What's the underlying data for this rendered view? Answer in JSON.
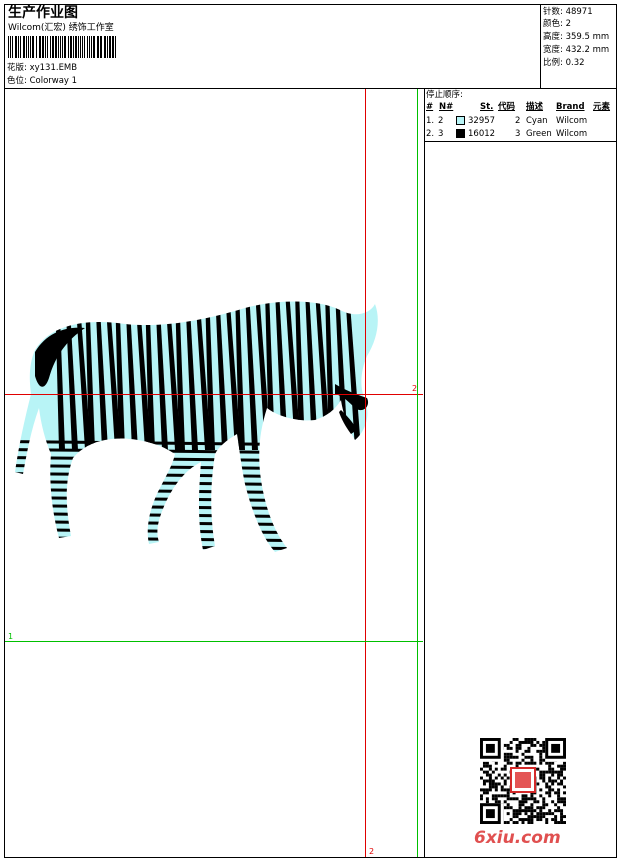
{
  "header": {
    "title": "生产作业图",
    "company": "Wilcom(汇宏) 绣饰工作室",
    "design_label": "花版:",
    "design_value": "xy131.EMB",
    "colorway_label": "色位:",
    "colorway_value": "Colorway 1"
  },
  "info": [
    {
      "label": "针数:",
      "value": "48971"
    },
    {
      "label": "颜色:",
      "value": "2"
    },
    {
      "label": "高度:",
      "value": "359.5 mm"
    },
    {
      "label": "宽度:",
      "value": "432.2 mm"
    },
    {
      "label": "比例:",
      "value": "0.32"
    }
  ],
  "stop_sequence": {
    "title": "停止顺序:",
    "headers": [
      "#",
      "N#",
      "St.",
      "代码",
      "描述",
      "Brand",
      "元素"
    ],
    "rows": [
      {
        "index": "1.",
        "needle": "2",
        "stitches": "32957",
        "code": "2",
        "desc": "Cyan",
        "brand": "Wilcom",
        "swatch": "#b8f4f6"
      },
      {
        "index": "2.",
        "needle": "3",
        "stitches": "16012",
        "code": "3",
        "desc": "Green",
        "brand": "Wilcom",
        "swatch": "#000000"
      }
    ]
  },
  "guides": {
    "red_h_label": "2",
    "red_v_label": "2",
    "green_h_label": "1",
    "red_color": "#e00000",
    "green_color": "#00c000"
  },
  "colors": {
    "cyan_fill": "#b8f4f6",
    "stripe": "#000000"
  },
  "watermark": "6xiu.com"
}
